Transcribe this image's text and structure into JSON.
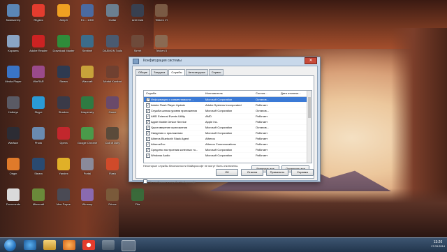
{
  "desktop": {
    "icons": [
      {
        "label": "Компьютер",
        "color": "#5b86b6"
      },
      {
        "label": "Яндекс",
        "color": "#e43c2e"
      },
      {
        "label": "Aimp3",
        "color": "#f0a022"
      },
      {
        "label": "Ex... 1000",
        "color": "#4b6aa0"
      },
      {
        "label": "Guitar",
        "color": "#6b7f90"
      },
      {
        "label": "Anti Dust",
        "color": "#384050"
      },
      {
        "label": "Tekken VI",
        "color": "#7a5a44"
      },
      {
        "label": "Корзина",
        "color": "#8aa4c4"
      },
      {
        "label": "Adobe Reader",
        "color": "#cc2222"
      },
      {
        "label": "Download Master",
        "color": "#2f8c3a"
      },
      {
        "label": "Sentinel",
        "color": "#3c6c8a"
      },
      {
        "label": "DAEMON Tools",
        "color": "#4a5a70"
      },
      {
        "label": "Street",
        "color": "#6e4a3a"
      },
      {
        "label": "Tekken 5",
        "color": "#8a6a52"
      },
      {
        "label": "Media Player",
        "color": "#3a74c6"
      },
      {
        "label": "WinRAR",
        "color": "#9a4a8a"
      },
      {
        "label": "Steam",
        "color": "#2e3a50"
      },
      {
        "label": "Warcraft",
        "color": "#c8a23a"
      },
      {
        "label": "Mortal Kombat",
        "color": "#704030"
      },
      {
        "label": "CCleaner",
        "color": "#c23a2a"
      },
      {
        "label": "Punto",
        "color": "#3a8c48"
      },
      {
        "label": "Hotkeys",
        "color": "#5a5a64"
      },
      {
        "label": "Skype",
        "color": "#2a9ad6"
      },
      {
        "label": "Shadow",
        "color": "#3a3a48"
      },
      {
        "label": "Kaspersky",
        "color": "#2f7a42"
      },
      {
        "label": "Game",
        "color": "#6a4a6a"
      },
      {
        "label": "Assassin",
        "color": "#8a2a2a"
      },
      {
        "label": "Dragon",
        "color": "#4a6a3a"
      },
      {
        "label": "Warface",
        "color": "#2c2c34"
      },
      {
        "label": "Photo",
        "color": "#6a8ab0"
      },
      {
        "label": "Opera",
        "color": "#c2272d"
      },
      {
        "label": "Google Chrome",
        "color": "#4a9a4a"
      },
      {
        "label": "Call of Duty",
        "color": "#5a4a3a"
      },
      {
        "label": "Crysis",
        "color": "#4a5a4a"
      },
      {
        "label": "Stalker",
        "color": "#7a5a3a"
      },
      {
        "label": "Origin",
        "color": "#e07a2a"
      },
      {
        "label": "Steam",
        "color": "#2a4a70"
      },
      {
        "label": "Yandex",
        "color": "#e0b028"
      },
      {
        "label": "Portal",
        "color": "#8a8a9a"
      },
      {
        "label": "Flash",
        "color": "#d04a2a"
      },
      {
        "label": "PhotoScape",
        "color": "#5a7a9a"
      },
      {
        "label": "Batman",
        "color": "#3a3a44"
      },
      {
        "label": "Documents",
        "color": "#dadada"
      },
      {
        "label": "Minecraft",
        "color": "#6a8a3a"
      },
      {
        "label": "Max Payne",
        "color": "#4a4a54"
      },
      {
        "label": "Winamp",
        "color": "#8a6ab0"
      },
      {
        "label": "Prince",
        "color": "#7a5a3a"
      },
      {
        "label": "Fifa",
        "color": "#3a6a3a"
      }
    ]
  },
  "window": {
    "title": "Конфигурация системы",
    "close_label": "✕",
    "tabs": [
      "Общие",
      "Загрузка",
      "Службы",
      "Автозагрузка",
      "Сервис"
    ],
    "active_tab": 2,
    "columns": [
      "Служба",
      "Изготовитель",
      "Состоя...",
      "Дата отключе..."
    ],
    "rows": [
      {
        "name": "Информация о совместимости ...",
        "maker": "Microsoft Corporation",
        "state": "Останов...",
        "checked": true,
        "selected": true
      },
      {
        "name": "Adobe Flash Player Update",
        "maker": "Adobe Systems Incorporated",
        "state": "Работает",
        "checked": true,
        "selected": false
      },
      {
        "name": "Служба шлюза уровня приложения",
        "maker": "Microsoft Corporation",
        "state": "Останов...",
        "checked": true,
        "selected": false
      },
      {
        "name": "AMD External Events Utility",
        "maker": "AMD",
        "state": "Работает",
        "checked": true,
        "selected": false
      },
      {
        "name": "Apple Mobile Device Service",
        "maker": "Apple Inc.",
        "state": "Работает",
        "checked": true,
        "selected": false
      },
      {
        "name": "Удостоверение приложения",
        "maker": "Microsoft Corporation",
        "state": "Останов...",
        "checked": true,
        "selected": false
      },
      {
        "name": "Сведения о приложении",
        "maker": "Microsoft Corporation",
        "state": "Работает",
        "checked": true,
        "selected": false
      },
      {
        "name": "Atheros Bluetooth Stack Agent",
        "maker": "Atheros",
        "state": "Работает",
        "checked": true,
        "selected": false
      },
      {
        "name": "AtherosSvc",
        "maker": "Atheros Commnucations",
        "state": "Работает",
        "checked": true,
        "selected": false
      },
      {
        "name": "Средство построения конечных то...",
        "maker": "Microsoft Corporation",
        "state": "Работает",
        "checked": true,
        "selected": false
      },
      {
        "name": "Windows Audio",
        "maker": "Microsoft Corporation",
        "state": "Работает",
        "checked": true,
        "selected": false
      }
    ],
    "note": "Некоторые службы безопасности Майкрософт не могут быть отключены.",
    "enable_all": "Включить все",
    "disable_all": "Отключить все",
    "hide_ms": "Не отображать службы Майкрософт",
    "ok": "ОК",
    "cancel": "Отмена",
    "apply": "Применить",
    "help": "Справка"
  },
  "taskbar": {
    "time": "13:26",
    "date": "17.03.2014"
  }
}
